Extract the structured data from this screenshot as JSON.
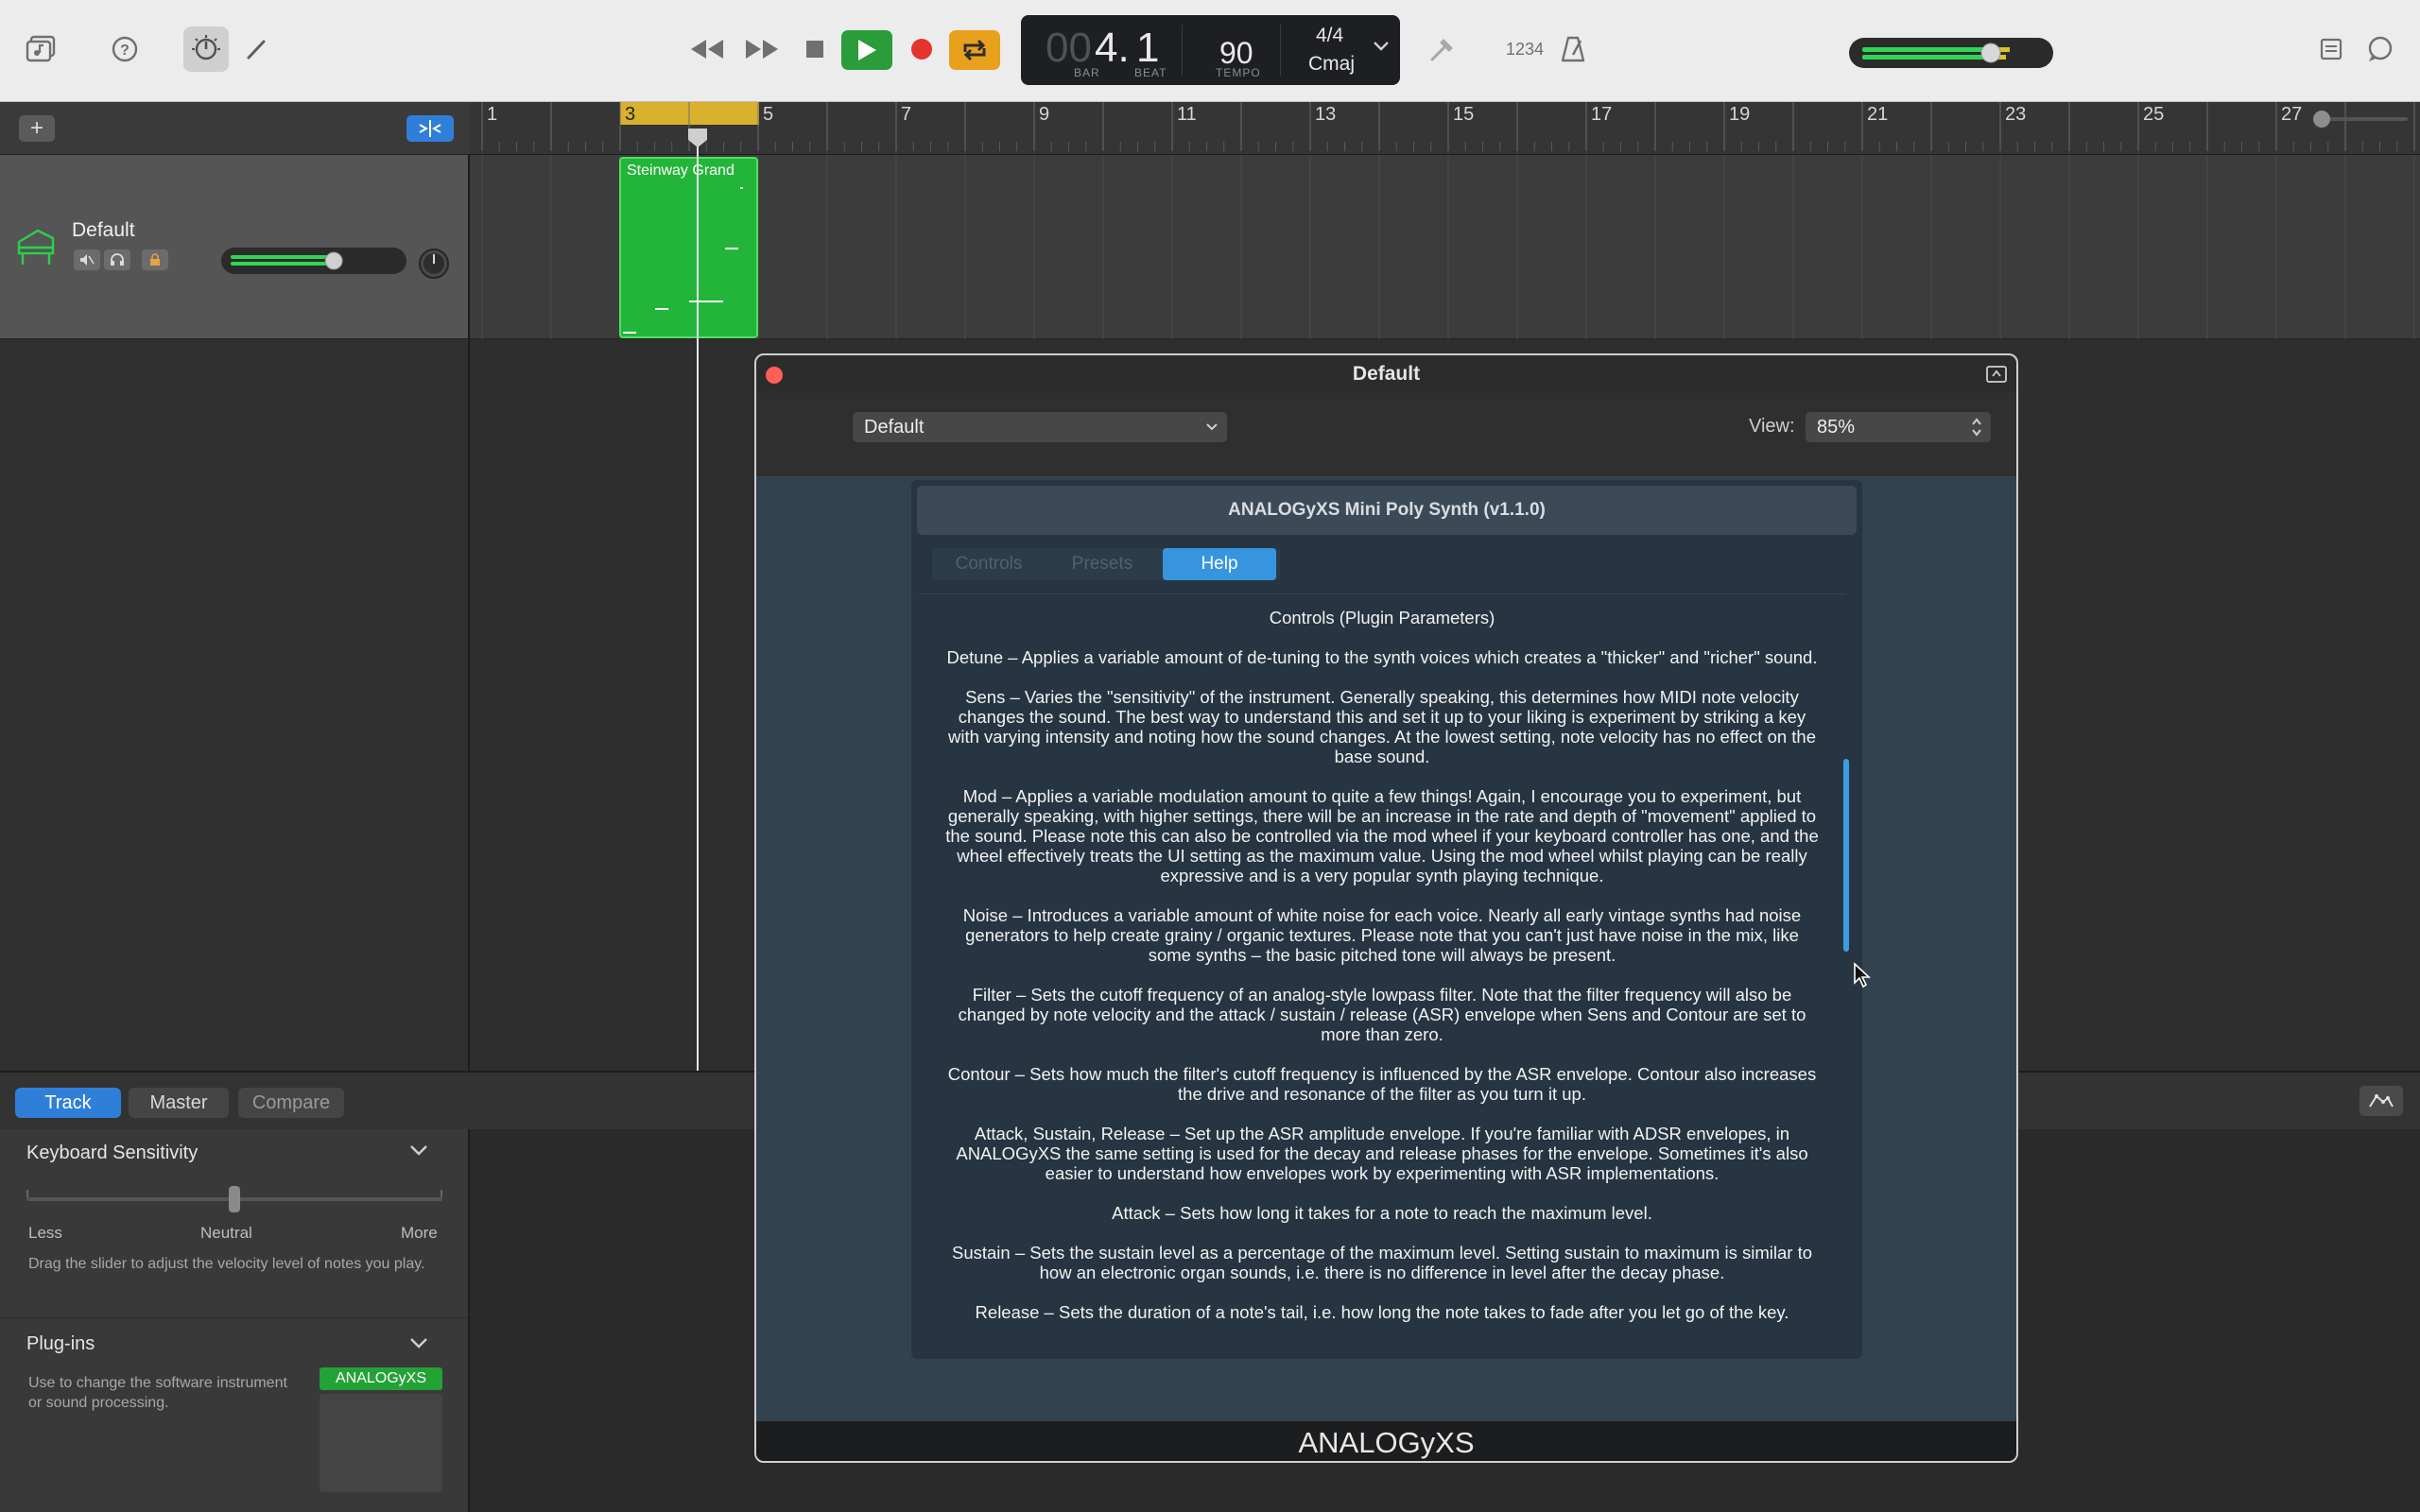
{
  "toolbar": {
    "lcd": {
      "bar_dim": "00",
      "bar": "4.",
      "beat": "1",
      "bar_label": "BAR",
      "beat_label": "BEAT",
      "tempo": "90",
      "tempo_label": "TEMPO",
      "time_signature": "4/4",
      "key": "Cmaj"
    },
    "count_in": "1234",
    "master_volume_fraction": 0.68,
    "accent": "#3478f6"
  },
  "track_header": {
    "add_label": "+"
  },
  "track": {
    "name": "Default",
    "volume_fraction": 0.62,
    "icon": "piano-icon",
    "color": "#23b53a"
  },
  "ruler": {
    "bars": [
      "1",
      "3",
      "5",
      "7",
      "9",
      "11",
      "13",
      "15",
      "17",
      "19",
      "21",
      "23",
      "25",
      "27"
    ],
    "cycle_start": "3"
  },
  "region": {
    "name": "Steinway Grand"
  },
  "smart_controls": {
    "tabs": [
      {
        "label": "Track"
      },
      {
        "label": "Master"
      },
      {
        "label": "Compare"
      }
    ],
    "keyboard_sensitivity": {
      "title": "Keyboard Sensitivity",
      "less": "Less",
      "neutral": "Neutral",
      "more": "More",
      "help": "Drag the slider to adjust the velocity level of notes you play.",
      "value_fraction": 0.5
    },
    "plugins": {
      "title": "Plug-ins",
      "help": "Use to change the software instrument or sound processing.",
      "slot": "ANALOGyXS"
    }
  },
  "plugin_window": {
    "title": "Default",
    "preset": "Default",
    "view_label": "View:",
    "view_value": "85%",
    "plugin_title": "ANALOGyXS Mini Poly Synth (v1.1.0)",
    "tabs": [
      {
        "label": "Controls"
      },
      {
        "label": "Presets"
      },
      {
        "label": "Help"
      }
    ],
    "active_tab": "Help",
    "brand": "ANALOGyXS",
    "help_paragraphs": [
      "Controls (Plugin Parameters)",
      "Detune – Applies a variable amount of de-tuning to the synth voices which creates a \"thicker\" and \"richer\" sound.",
      "Sens – Varies the \"sensitivity\" of the instrument. Generally speaking, this determines how MIDI note velocity changes the sound. The best way to understand this and set it up to your liking is experiment by striking a key with varying intensity and noting how the sound changes. At the lowest setting, note velocity has no effect on the base sound.",
      "Mod – Applies a variable modulation amount to quite a few things! Again, I encourage you to experiment, but generally speaking, with higher settings, there will be an increase in the rate and depth of \"movement\" applied to the sound. Please note this can also be controlled via the mod wheel if your keyboard controller has one, and the wheel effectively treats the UI setting as the maximum value. Using the mod wheel whilst playing can be really expressive and is a very popular synth playing technique.",
      "Noise – Introduces a variable amount of white noise for each voice. Nearly all early vintage synths had noise generators to help create grainy / organic textures. Please note that you can't just have noise in the mix, like some synths – the basic pitched tone will always be present.",
      "Filter – Sets the cutoff frequency of an analog-style lowpass filter. Note that the filter frequency will also be changed by note velocity and the attack / sustain / release (ASR) envelope when Sens and Contour are set to more than zero.",
      "Contour – Sets how much the filter's cutoff frequency is influenced by the ASR envelope. Contour also increases the drive and resonance of the filter as you turn it up.",
      "Attack, Sustain, Release – Set up the ASR amplitude envelope. If you're familiar with ADSR envelopes, in ANALOGyXS the same setting is used for the decay and release phases for the envelope. Sometimes it's also easier to understand how envelopes work by experimenting with ASR implementations.",
      "Attack – Sets how long it takes for a note to reach the maximum level.",
      "Sustain – Sets the sustain level as a percentage of the maximum level. Setting sustain to maximum is similar to how an electronic organ sounds, i.e. there is no difference in level after the decay phase.",
      "Release – Sets the duration of a note's tail, i.e. how long the note takes to fade after you let go of the key."
    ]
  }
}
